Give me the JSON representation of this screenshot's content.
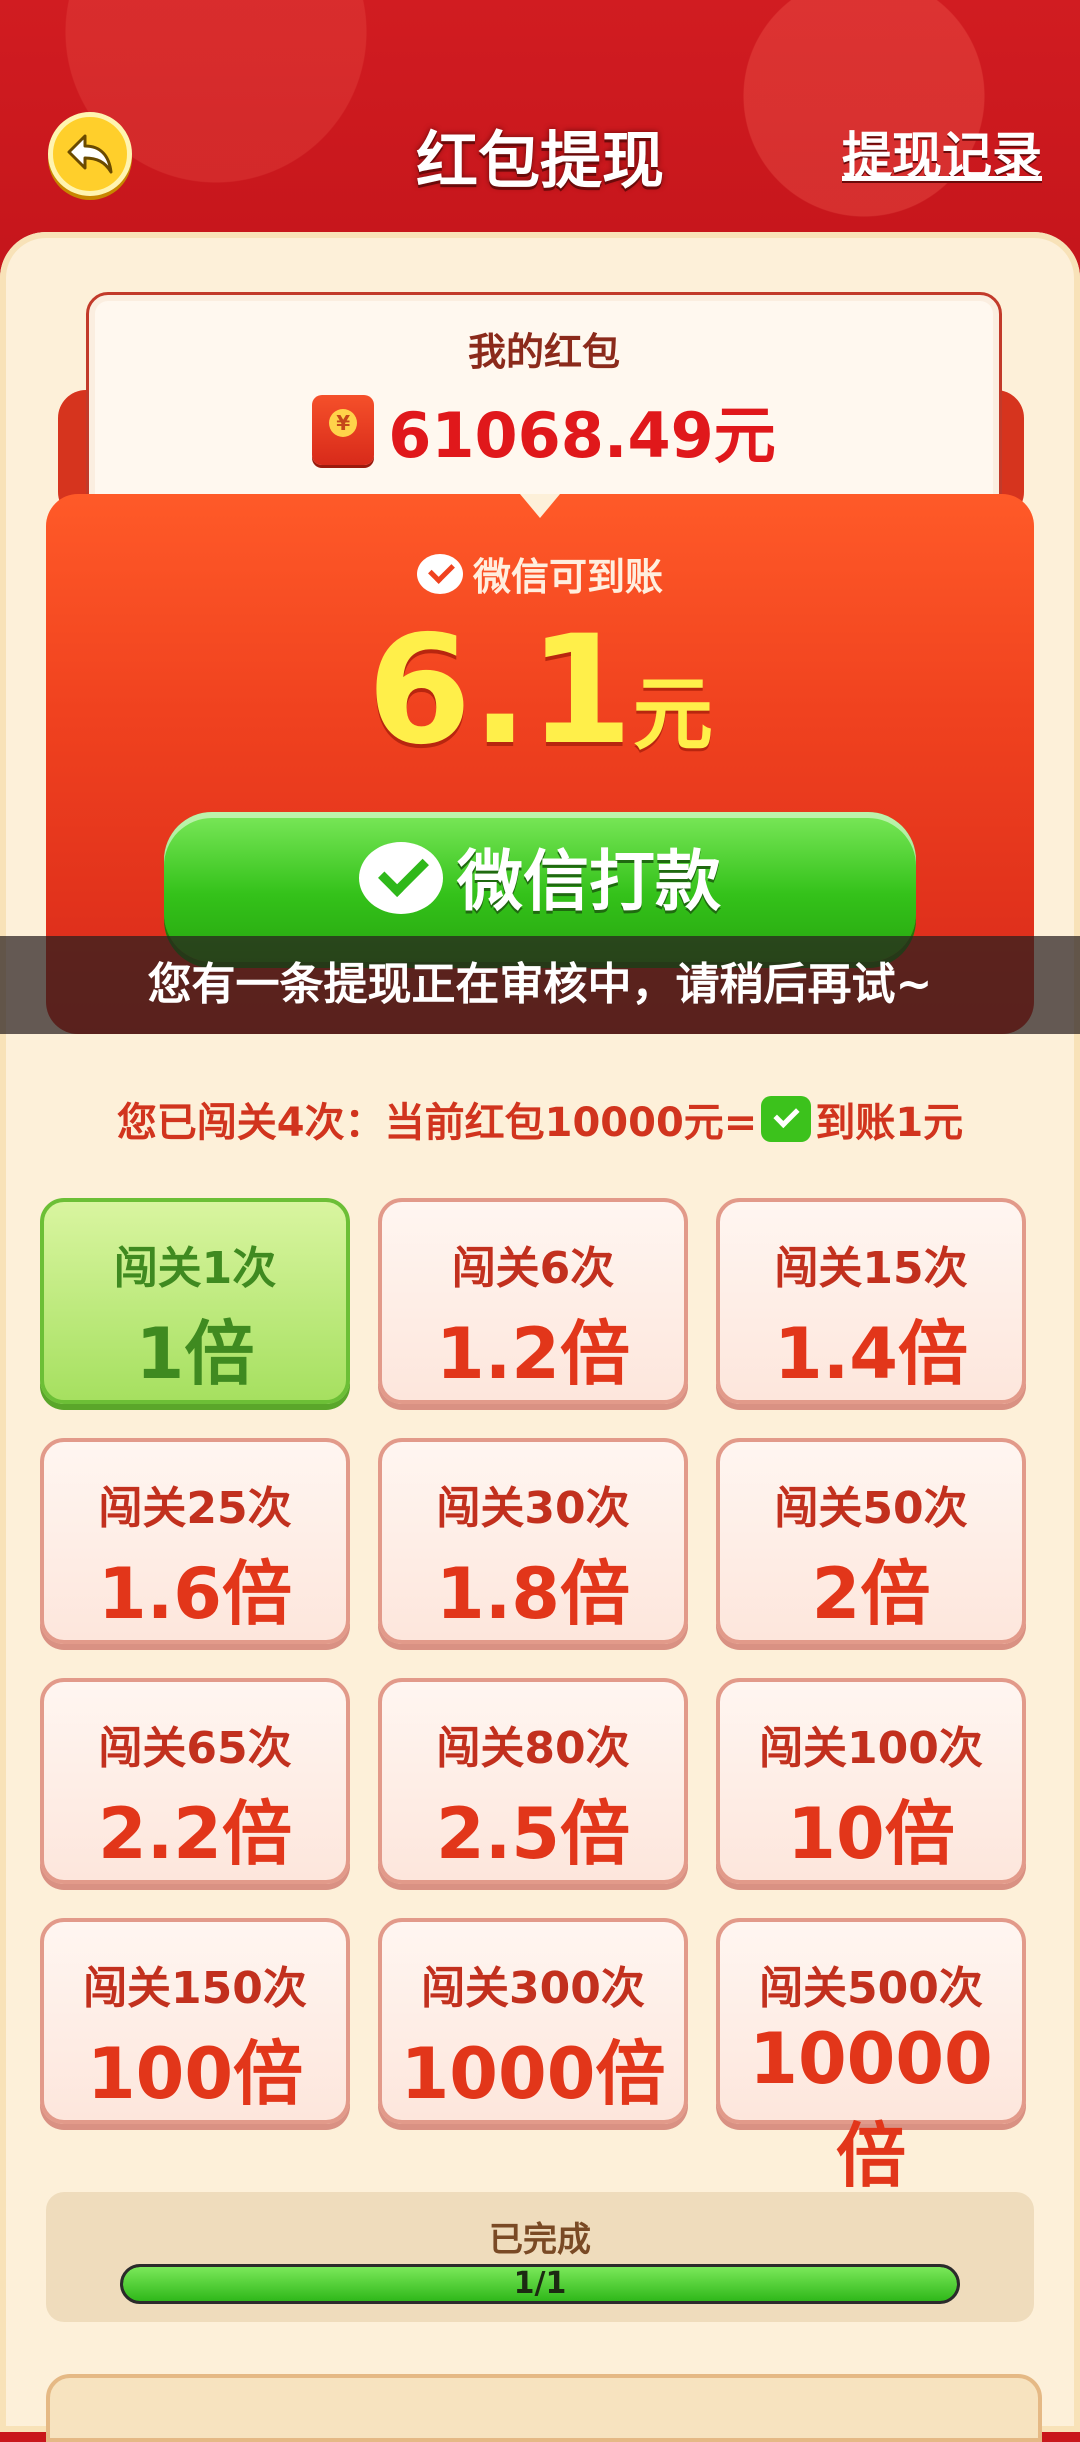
{
  "header": {
    "title": "红包提现",
    "record_label": "提现记录"
  },
  "wallet": {
    "label": "我的红包",
    "amount": "61068.49元"
  },
  "withdraw": {
    "arrival_label": "微信可到账",
    "amount": "6.1",
    "unit": "元",
    "pay_button_label": "微信打款"
  },
  "toast": {
    "message": "您有一条提现正在审核中，请稍后再试~"
  },
  "info": {
    "text_before": "您已闯关4次：当前红包10000元=",
    "text_after": "到账1元"
  },
  "tiers": [
    {
      "clears": "闯关1次",
      "multiplier": "1倍",
      "active": true
    },
    {
      "clears": "闯关6次",
      "multiplier": "1.2倍",
      "active": false
    },
    {
      "clears": "闯关15次",
      "multiplier": "1.4倍",
      "active": false
    },
    {
      "clears": "闯关25次",
      "multiplier": "1.6倍",
      "active": false
    },
    {
      "clears": "闯关30次",
      "multiplier": "1.8倍",
      "active": false
    },
    {
      "clears": "闯关50次",
      "multiplier": "2倍",
      "active": false
    },
    {
      "clears": "闯关65次",
      "multiplier": "2.2倍",
      "active": false
    },
    {
      "clears": "闯关80次",
      "multiplier": "2.5倍",
      "active": false
    },
    {
      "clears": "闯关100次",
      "multiplier": "10倍",
      "active": false
    },
    {
      "clears": "闯关150次",
      "multiplier": "100倍",
      "active": false
    },
    {
      "clears": "闯关300次",
      "multiplier": "1000倍",
      "active": false
    },
    {
      "clears": "闯关500次",
      "multiplier": "10000倍",
      "active": false
    }
  ],
  "progress": {
    "label": "已完成",
    "text": "1/1",
    "fraction": 1.0
  },
  "colors": {
    "header_red": "#c9161b",
    "panel_cream": "#fdf0d9",
    "pay_green": "#34c21a",
    "payout_yellow": "#ffef4a"
  },
  "icons": {
    "back": "back-arrow-icon",
    "wechat": "wechat-icon",
    "redpack": "red-envelope-icon"
  }
}
